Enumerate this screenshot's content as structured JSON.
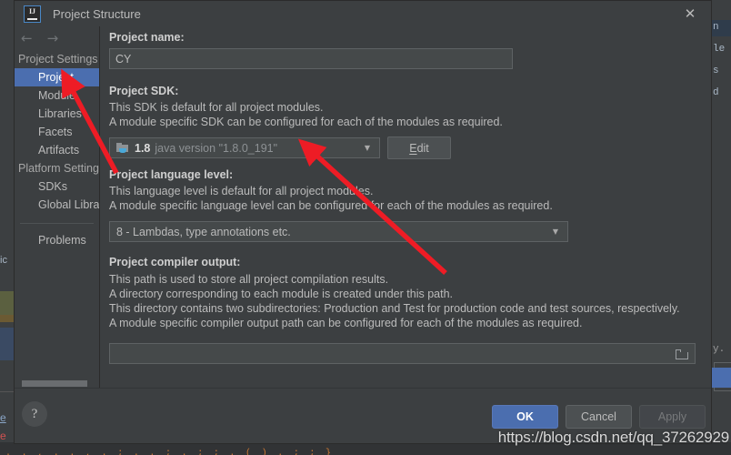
{
  "window": {
    "title": "Project Structure",
    "app_icon": "intellij-idea-icon",
    "icon_text": "IJ",
    "close_glyph": "✕"
  },
  "nav": {
    "back_glyph": "←",
    "forward_glyph": "→"
  },
  "sidebar": {
    "groups": [
      {
        "label": "Project Settings",
        "items": [
          {
            "label": "Project",
            "selected": true
          },
          {
            "label": "Module",
            "selected": false
          },
          {
            "label": "Libraries",
            "selected": false
          },
          {
            "label": "Facets",
            "selected": false
          },
          {
            "label": "Artifacts",
            "selected": false
          }
        ]
      },
      {
        "label": "Platform Setting",
        "items": [
          {
            "label": "SDKs",
            "selected": false
          },
          {
            "label": "Global Libra",
            "selected": false
          }
        ]
      }
    ],
    "extra_items": [
      {
        "label": "Problems",
        "selected": false
      }
    ]
  },
  "main": {
    "project_name": {
      "label": "Project name:",
      "value": "CY"
    },
    "project_sdk": {
      "label": "Project SDK:",
      "desc_line1": "This SDK is default for all project modules.",
      "desc_line2": "A module specific SDK can be configured for each of the modules as required.",
      "selected_version": "1.8",
      "selected_detail": "java version \"1.8.0_191\"",
      "caret_glyph": "▼",
      "edit_button": "Edit",
      "edit_mnemonic": "E",
      "edit_rest": "dit"
    },
    "language_level": {
      "label": "Project language level:",
      "desc_line1": "This language level is default for all project modules.",
      "desc_line2": "A module specific language level can be configured for each of the modules as required.",
      "selected": "8 - Lambdas, type annotations etc.",
      "caret_glyph": "▼"
    },
    "compiler_output": {
      "label": "Project compiler output:",
      "desc_line1": "This path is used to store all project compilation results.",
      "desc_line2": "A directory corresponding to each module is created under this path.",
      "desc_line3": "This directory contains two subdirectories: Production and Test for production code and test sources, respectively.",
      "desc_line4": "A module specific compiler output path can be configured for each of the modules as required.",
      "value": "",
      "browse_icon": "folder-browse-icon"
    }
  },
  "footer": {
    "help_glyph": "?",
    "ok_label": "OK",
    "cancel_label": "Cancel",
    "apply_label": "Apply"
  },
  "watermark": {
    "text": "https://blog.csdn.net/qq_37262929"
  },
  "background": {
    "left_label": "ic",
    "left_tab_a": "e",
    "left_tab_b": "e",
    "right_lines": [
      "n",
      "le",
      "s",
      "d"
    ],
    "right_tail": "y.",
    "bottom_code": ". . , . . , . ; . . ; . ; ; . ( ) . ; ; }"
  },
  "colors": {
    "dialog_bg": "#3c3f41",
    "field_bg": "#45494a",
    "selection_blue": "#4b6eaf",
    "accent_arrow_red": "#ee1c25",
    "text_primary": "#bbbbbb",
    "text_bold": "#cfcfcf",
    "text_dim": "#8d9194",
    "editor_bg": "#2b2b2b"
  }
}
